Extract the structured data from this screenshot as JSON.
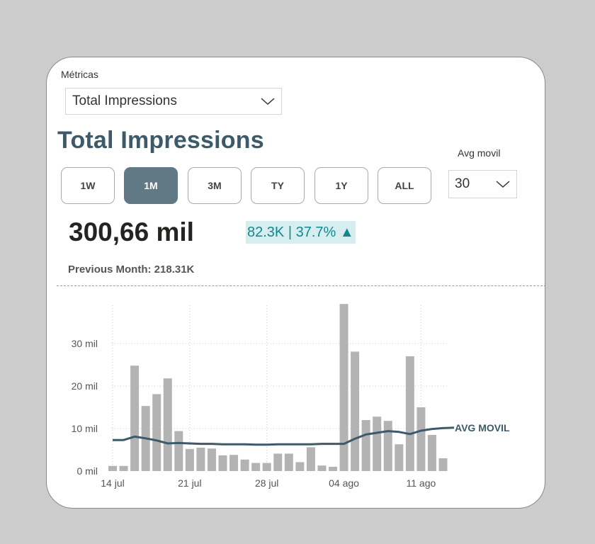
{
  "filter": {
    "label": "Métricas",
    "selected": "Total Impressions"
  },
  "title": "Total Impressions",
  "avg_movil": {
    "label": "Avg movil",
    "selected": "30"
  },
  "ranges": [
    {
      "label": "1W",
      "active": false
    },
    {
      "label": "1M",
      "active": true
    },
    {
      "label": "3M",
      "active": false
    },
    {
      "label": "TY",
      "active": false
    },
    {
      "label": "1Y",
      "active": false
    },
    {
      "label": "ALL",
      "active": false
    }
  ],
  "kpi": {
    "value": "300,66 mil",
    "delta": "82.3K | 37.7% ▲",
    "previous": "Previous Month: 218.31K"
  },
  "colors": {
    "accent": "#3c5a69",
    "active_button": "#607985",
    "bar": "#b3b3b3",
    "line": "#3c5a69",
    "delta_bg": "#d6eeef",
    "delta_text": "#13878f"
  },
  "chart_data": {
    "type": "bar",
    "x_tick_labels": [
      "14 jul",
      "21 jul",
      "28 jul",
      "04 ago",
      "11 ago"
    ],
    "y_tick_labels": [
      "0 mil",
      "10 mil",
      "20 mil",
      "30 mil"
    ],
    "ylim": [
      0,
      39000
    ],
    "grid": true,
    "bars": [
      1200,
      1200,
      24800,
      15300,
      18100,
      21800,
      9400,
      5200,
      5500,
      5300,
      3700,
      3800,
      2700,
      1900,
      1900,
      4100,
      4100,
      2100,
      5600,
      1300,
      1000,
      39300,
      28100,
      12000,
      12800,
      11800,
      6300,
      27000,
      15000,
      8500,
      3000
    ],
    "series": [
      {
        "name": "AVG MOVIL",
        "type": "line",
        "values": [
          7300,
          7300,
          8100,
          7700,
          7200,
          6500,
          6600,
          6500,
          6400,
          6400,
          6300,
          6300,
          6300,
          6200,
          6200,
          6300,
          6300,
          6300,
          6300,
          6400,
          6400,
          6400,
          7600,
          8600,
          9000,
          9400,
          9200,
          8700,
          9500,
          9900,
          10100,
          10200
        ]
      }
    ]
  }
}
